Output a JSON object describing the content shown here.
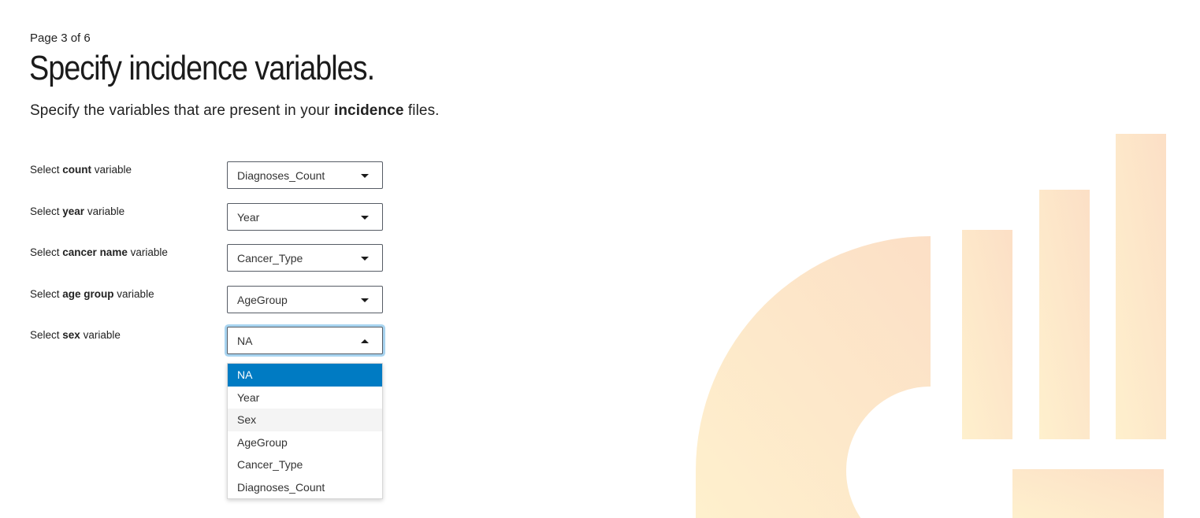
{
  "header": {
    "page_indicator": "Page 3 of 6",
    "title": "Specify incidence variables.",
    "subtitle_prefix": "Specify the variables that are present in your ",
    "subtitle_bold": "incidence",
    "subtitle_suffix": " files."
  },
  "form": {
    "fields": [
      {
        "label_prefix": "Select ",
        "label_bold": "count",
        "label_suffix": " variable",
        "value": "Diagnoses_Count"
      },
      {
        "label_prefix": "Select ",
        "label_bold": "year",
        "label_suffix": " variable",
        "value": "Year"
      },
      {
        "label_prefix": "Select ",
        "label_bold": "cancer name",
        "label_suffix": " variable",
        "value": "Cancer_Type"
      },
      {
        "label_prefix": "Select ",
        "label_bold": "age group",
        "label_suffix": " variable",
        "value": "AgeGroup"
      },
      {
        "label_prefix": "Select ",
        "label_bold": "sex",
        "label_suffix": " variable",
        "value": "NA"
      }
    ],
    "open_dropdown": {
      "options": [
        "NA",
        "Year",
        "Sex",
        "AgeGroup",
        "Cancer_Type",
        "Diagnoses_Count"
      ],
      "selected": "NA",
      "hovered": "Sex"
    }
  },
  "icons": {
    "dropdown_caret": "caret-down-icon",
    "dropdown_caret_open": "caret-up-icon",
    "background_logo": "chart-logo-icon"
  },
  "colors": {
    "accent": "#007bc3",
    "focus_ring": "#a8d4f0",
    "logo_fill_light": "#fdebc8",
    "logo_fill_peach": "#fce0c4"
  }
}
